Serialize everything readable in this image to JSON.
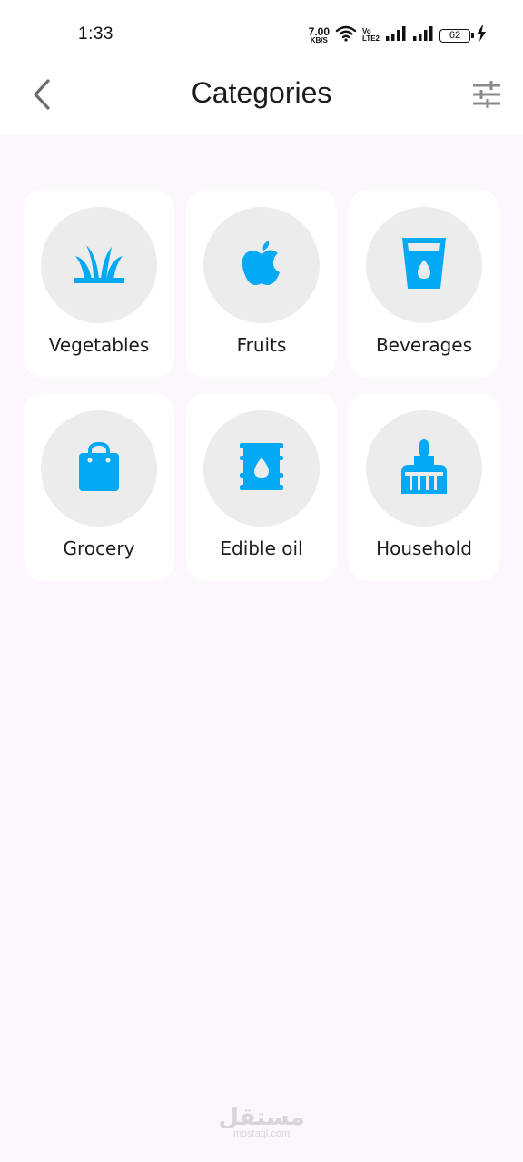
{
  "status_bar": {
    "time": "1:33",
    "net_speed_value": "7.00",
    "net_speed_unit": "KB/S",
    "volte_top": "Vo",
    "volte_bottom": "LTE2",
    "battery_level": "62"
  },
  "header": {
    "title": "Categories",
    "back_icon": "chevron-left-icon",
    "filter_icon": "tune-sliders-icon"
  },
  "categories": [
    {
      "label": "Vegetables",
      "icon": "grass-icon"
    },
    {
      "label": "Fruits",
      "icon": "apple-icon"
    },
    {
      "label": "Beverages",
      "icon": "water-glass-icon"
    },
    {
      "label": "Grocery",
      "icon": "shopping-bag-icon"
    },
    {
      "label": "Edible oil",
      "icon": "oil-barrel-icon"
    },
    {
      "label": "Household",
      "icon": "cleaning-brush-icon"
    }
  ],
  "colors": {
    "accent": "#03a9f4",
    "background": "#fcf6fd",
    "card": "#ffffff",
    "icon_circle": "#ececec"
  },
  "watermark": {
    "arabic": "مستقل",
    "latin": "mostaql.com"
  }
}
